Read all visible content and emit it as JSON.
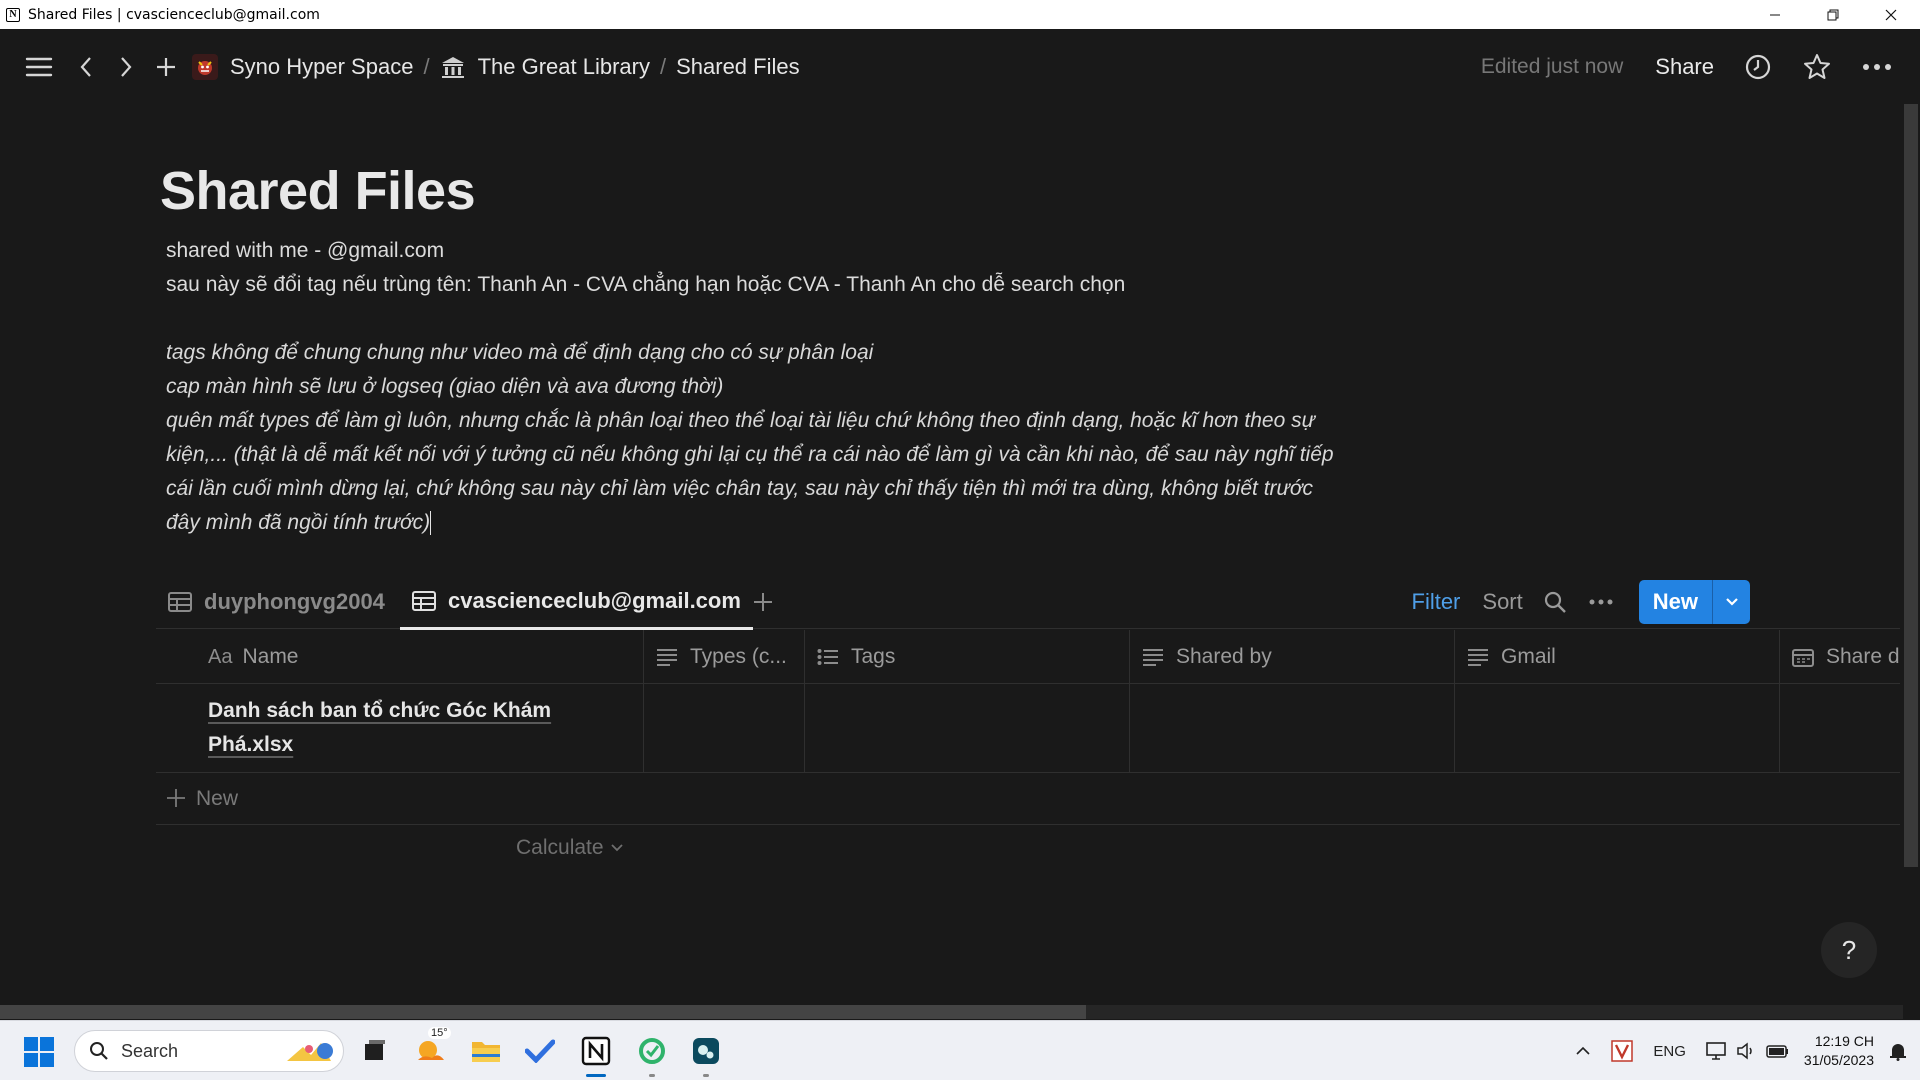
{
  "window": {
    "title": "Shared Files | cvascienceclub@gmail.com"
  },
  "topbar": {
    "breadcrumbs": [
      {
        "label": "Syno Hyper Space"
      },
      {
        "label": "The Great Library"
      },
      {
        "label": "Shared Files"
      }
    ],
    "edited": "Edited just now",
    "share_label": "Share"
  },
  "page": {
    "title": "Shared Files",
    "lines": [
      "shared with me  - @gmail.com",
      "sau này sẽ đổi tag nếu trùng tên: Thanh An - CVA chẳng hạn hoặc CVA - Thanh An cho dễ search chọn"
    ],
    "italic_lines": [
      "tags không để chung chung như video mà để định dạng cho có sự phân loại",
      "cap màn hình sẽ lưu ở logseq (giao diện và ava đương thời)",
      "quên mất types để làm gì luôn, nhưng chắc là phân loại theo thể loại tài liệu chứ không theo định dạng, hoặc kĩ hơn theo sự",
      "kiện,... (thật là dễ mất kết nối với ý tưởng cũ nếu không ghi lại cụ thể ra cái nào để làm gì và cần khi nào, để sau này nghĩ tiếp",
      "cái lần cuối mình dừng lại, chứ không sau này chỉ làm việc chân tay, sau này chỉ thấy tiện thì mới tra dùng, không biết trước",
      "đây mình đã ngồi tính trước)"
    ]
  },
  "views": {
    "tabs": [
      {
        "label": "duyphongvg2004",
        "active": false
      },
      {
        "label": "cvascienceclub@gmail.com",
        "active": true
      }
    ],
    "filter_label": "Filter",
    "sort_label": "Sort",
    "new_label": "New"
  },
  "table": {
    "name_prefix": "Aa",
    "columns": [
      "Name",
      "Types (c...",
      "Tags",
      "Shared by",
      "Gmail",
      "Share d"
    ],
    "rows": [
      {
        "name_line1": "Danh sách ban tổ chức Góc Khám",
        "name_line2": "Phá.xlsx"
      }
    ],
    "add_row_label": "New",
    "calculate_label": "Calculate"
  },
  "help_label": "?",
  "taskbar": {
    "search_label": "Search",
    "weather_temp": "15°",
    "tray_lang": "ENG",
    "time": "12:19 CH",
    "date": "31/05/2023"
  },
  "colors": {
    "accent": "#2383e2",
    "filter": "#4f9fe8",
    "background": "#191919"
  }
}
